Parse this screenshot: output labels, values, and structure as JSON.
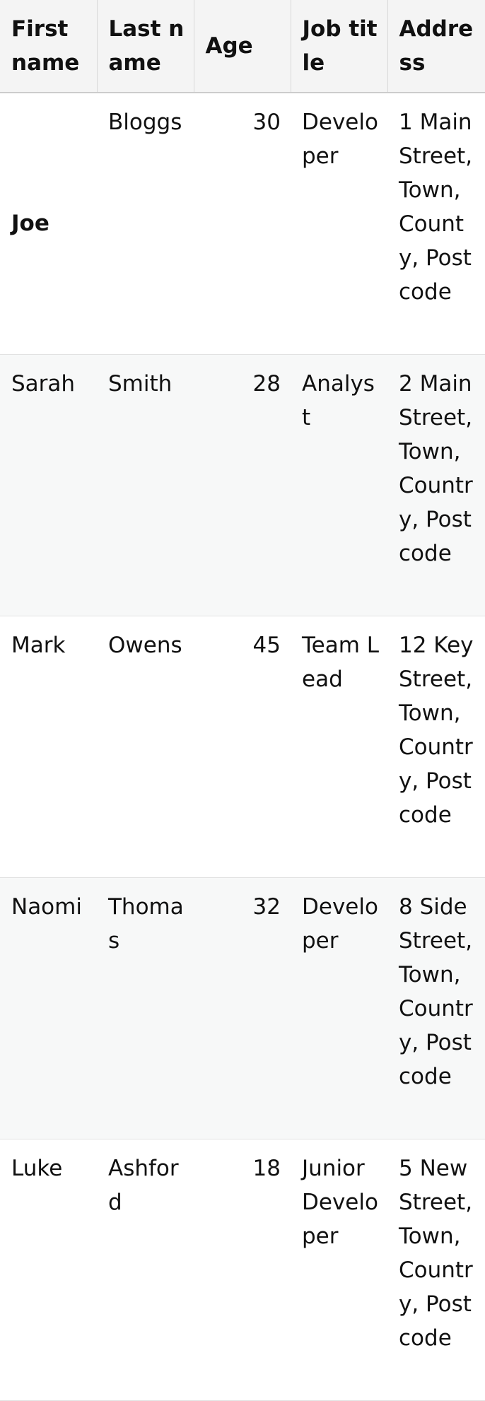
{
  "table": {
    "headers": [
      "First name",
      "Last name",
      "Age",
      "Job title",
      "Address"
    ],
    "rows": [
      {
        "first": "Joe",
        "last": "Bloggs",
        "age": "30",
        "job": "Developer",
        "address": "1 Main Street, Town, County, Postcode"
      },
      {
        "first": "Sarah",
        "last": "Smith",
        "age": "28",
        "job": "Analyst",
        "address": "2 Main Street, Town, Country, Postcode"
      },
      {
        "first": "Mark",
        "last": "Owens",
        "age": "45",
        "job": "Team Lead",
        "address": "12 Key Street, Town, Country, Postcode"
      },
      {
        "first": "Naomi",
        "last": "Thomas",
        "age": "32",
        "job": "Developer",
        "address": "8 Side Street, Town, Country, Postcode"
      },
      {
        "first": "Luke",
        "last": "Ashford",
        "age": "18",
        "job": "Junior Developer",
        "address": "5 New Street, Town, Country, Postcode"
      }
    ]
  }
}
